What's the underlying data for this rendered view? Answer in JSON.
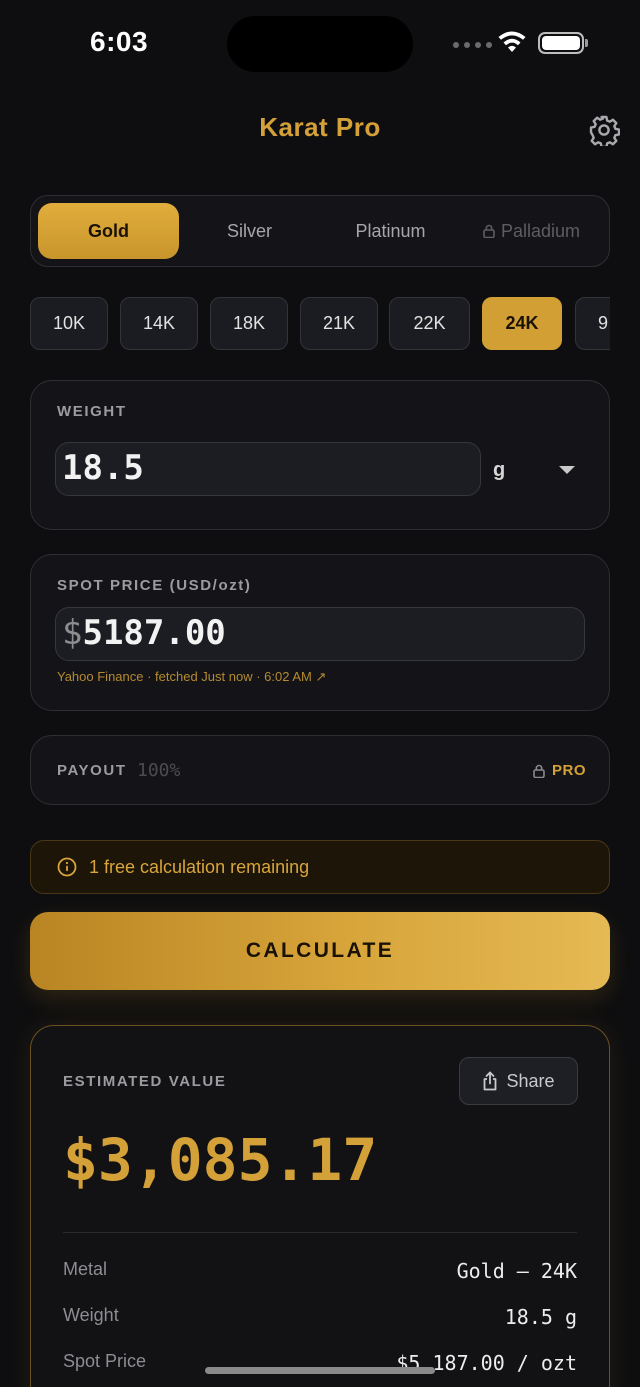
{
  "status": {
    "time": "6:03"
  },
  "header": {
    "title": "Karat Pro",
    "settings_icon": "gear-icon"
  },
  "metals": [
    {
      "label": "Gold",
      "active": true,
      "locked": false
    },
    {
      "label": "Silver",
      "active": false,
      "locked": false
    },
    {
      "label": "Platinum",
      "active": false,
      "locked": false
    },
    {
      "label": "Palladium",
      "active": false,
      "locked": true
    }
  ],
  "karats": [
    {
      "label": "10K",
      "active": false
    },
    {
      "label": "14K",
      "active": false
    },
    {
      "label": "18K",
      "active": false
    },
    {
      "label": "21K",
      "active": false
    },
    {
      "label": "22K",
      "active": false
    },
    {
      "label": "24K",
      "active": true
    },
    {
      "label": "9",
      "active": false
    }
  ],
  "weight": {
    "label": "WEIGHT",
    "value": "18.5",
    "unit": "g"
  },
  "spot": {
    "label": "SPOT PRICE (USD/ozt)",
    "currency": "$",
    "value": "5187.00",
    "source": "Yahoo Finance · fetched Just now · 6:02 AM ↗"
  },
  "payout": {
    "label": "PAYOUT",
    "value": "100%",
    "badge": "PRO"
  },
  "banner": {
    "text": "1 free calculation remaining"
  },
  "calculate": {
    "label": "CALCULATE"
  },
  "result": {
    "label": "ESTIMATED VALUE",
    "share_label": "Share",
    "total": "$3,085.17",
    "rows": [
      {
        "label": "Metal",
        "value": "Gold — 24K"
      },
      {
        "label": "Weight",
        "value": "18.5 g"
      },
      {
        "label": "Spot Price",
        "value": "$5,187.00 / ozt"
      }
    ]
  },
  "colors": {
    "accent": "#d4a038",
    "background": "#0e0e10",
    "card": "#141418"
  }
}
